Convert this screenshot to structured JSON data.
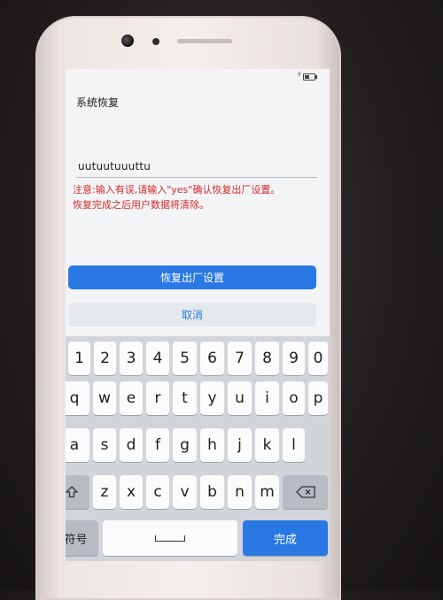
{
  "screen": {
    "title": "系统恢复",
    "input_value": "uutuutuuuttu",
    "warning_line1": "注意:输入有误,请输入\"yes\"确认恢复出厂设置。",
    "warning_line2": "恢复完成之后用户数据将清除。",
    "primary_button": "恢复出厂设置",
    "secondary_button": "取消"
  },
  "colors": {
    "accent": "#2a78e4",
    "warning": "#d22b2b",
    "keyboard_bg": "#d1d5da"
  },
  "keyboard": {
    "row_numbers": [
      "1",
      "2",
      "3",
      "4",
      "5",
      "6",
      "7",
      "8",
      "9",
      "0"
    ],
    "row_q": [
      "q",
      "w",
      "e",
      "r",
      "t",
      "y",
      "u",
      "i",
      "o",
      "p"
    ],
    "row_a": [
      "a",
      "s",
      "d",
      "f",
      "g",
      "h",
      "j",
      "k",
      "l"
    ],
    "row_z": [
      "z",
      "x",
      "c",
      "v",
      "b",
      "n",
      "m"
    ],
    "shift_icon": "shift-arrow-icon",
    "delete_icon": "backspace-icon",
    "symbols_label": "符号",
    "space_icon": "space-bar-icon",
    "done_label": "完成"
  }
}
